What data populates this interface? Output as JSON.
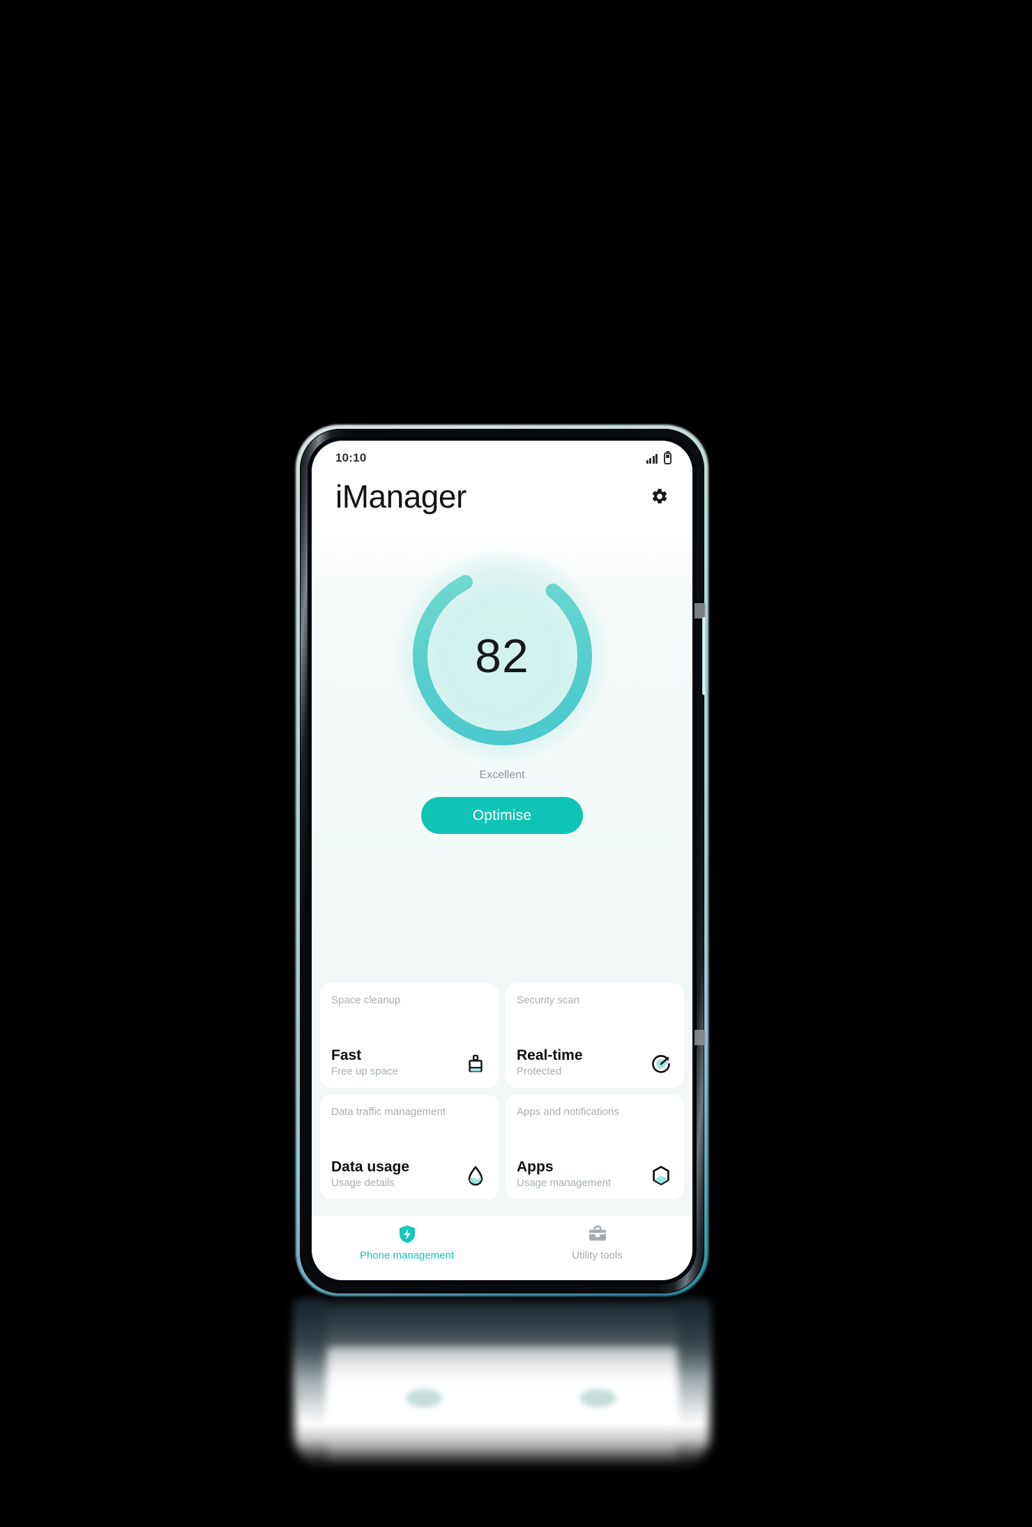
{
  "status_bar": {
    "time": "10:10",
    "signal_icon": "signal-bars-icon",
    "battery_icon": "battery-icon"
  },
  "header": {
    "title": "iManager",
    "settings_icon": "gear-icon"
  },
  "score_panel": {
    "score": "82",
    "status_label": "Excellent",
    "optimise_label": "Optimise",
    "ring_percent": 82,
    "accent_color": "#0ec4b5",
    "ring_color_start": "#6ad6cd",
    "ring_color_end": "#4cc8cb",
    "ring_track_color": "#ddf2f0"
  },
  "cards": [
    {
      "category": "Space cleanup",
      "title": "Fast",
      "subtitle": "Free up space",
      "icon": "broom-cleanup-icon"
    },
    {
      "category": "Security scan",
      "title": "Real-time",
      "subtitle": "Protected",
      "icon": "shield-gauge-icon"
    },
    {
      "category": "Data traffic management",
      "title": "Data usage",
      "subtitle": "Usage details",
      "icon": "water-drop-icon"
    },
    {
      "category": "Apps and notifications",
      "title": "Apps",
      "subtitle": "Usage management",
      "icon": "hexagon-apps-icon"
    }
  ],
  "bottom_nav": [
    {
      "label": "Phone management",
      "icon": "shield-bolt-icon",
      "active": true,
      "color": "#14c8bb"
    },
    {
      "label": "Utility tools",
      "icon": "toolbox-icon",
      "active": false,
      "color": "#a3abad"
    }
  ]
}
